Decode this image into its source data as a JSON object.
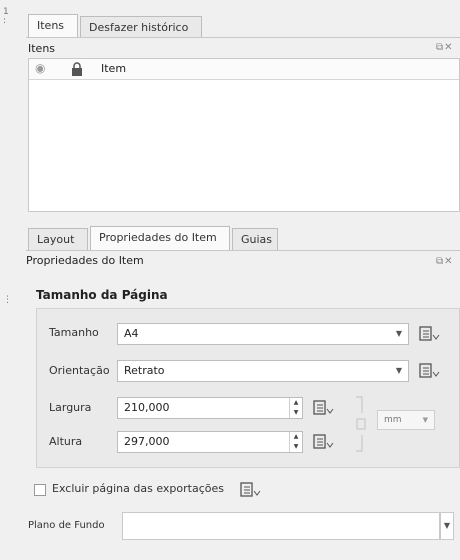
{
  "top_tabs": [
    "Itens",
    "Desfazer histórico"
  ],
  "items_panel": {
    "title": "Itens",
    "columns": [
      "Item"
    ]
  },
  "bottom_tabs": [
    "Layout",
    "Propriedades do Item",
    "Guias"
  ],
  "properties_panel": {
    "title": "Propriedades do Item",
    "group_title": "Tamanho da Página",
    "size": {
      "label": "Tamanho",
      "value": "A4"
    },
    "orientation": {
      "label": "Orientação",
      "value": "Retrato"
    },
    "width": {
      "label": "Largura",
      "value": "210,000"
    },
    "height": {
      "label": "Altura",
      "value": "297,000"
    },
    "units": {
      "value": "mm"
    },
    "exclude_label": "Excluir página das exportações",
    "background_label": "Plano de Fundo"
  },
  "colors": {
    "accent": "#3d6fb0",
    "panel_bg": "#eaeaea",
    "window_bg": "#f0f0f0"
  }
}
